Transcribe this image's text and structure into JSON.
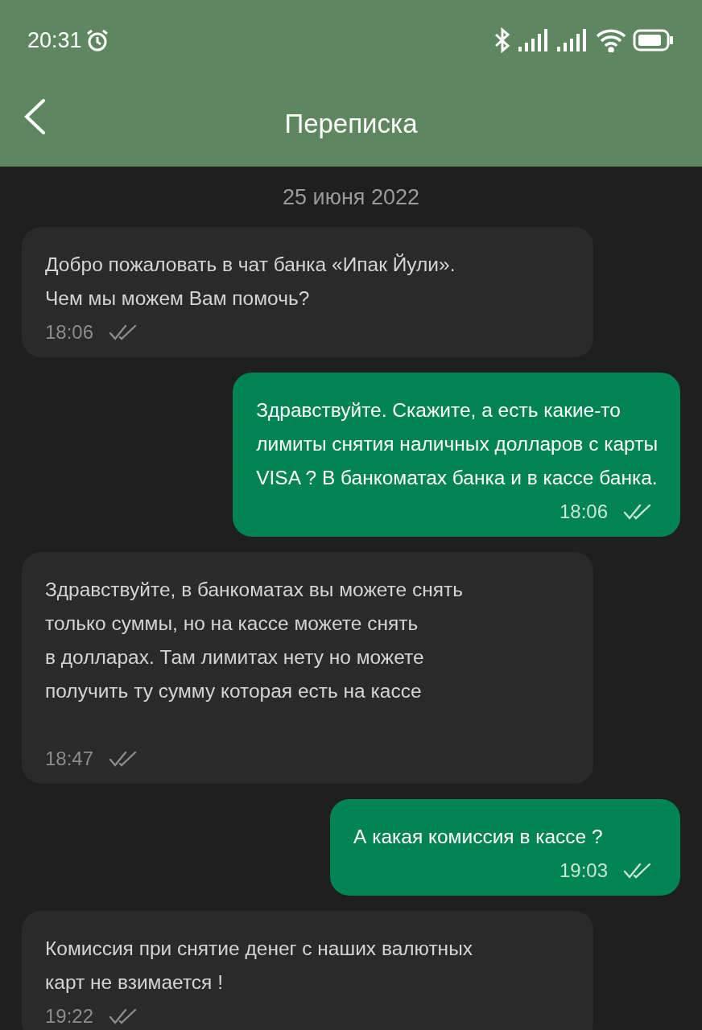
{
  "status_bar": {
    "time": "20:31"
  },
  "header": {
    "title": "Переписка"
  },
  "date": "25 июня 2022",
  "messages": [
    {
      "kind": "incoming",
      "text": "Добро пожаловать в чат банка «Ипак Йули».\nЧем мы можем Вам помочь?",
      "time": "18:06"
    },
    {
      "kind": "outgoing",
      "text": "Здравствуйте. Скажите, а есть какие-то\nлимиты снятия наличных долларов с карты\nVISA ? В банкоматах банка и в кассе банка.",
      "time": "18:06"
    },
    {
      "kind": "incoming",
      "text": "Здравствуйте, в банкоматах вы можете снять\nтолько суммы, но на кассе можете снять\nв долларах. Там лимитах нету но можете\nполучить ту сумму которая есть на кассе\n\n",
      "time": "18:47"
    },
    {
      "kind": "outgoing",
      "text": "А какая комиссия в кассе ?",
      "time": "19:03"
    },
    {
      "kind": "incoming",
      "text": "Комиссия при снятие денег с наших валютных\nкарт не взимается !",
      "time": "19:22"
    }
  ]
}
